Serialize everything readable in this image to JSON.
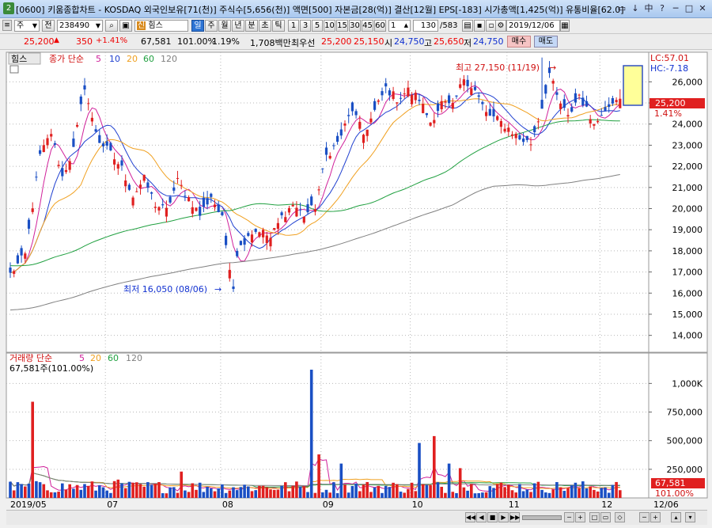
{
  "window": {
    "title": "[0600] 키움종합차트 - KOSDAQ 외국인보유[71(천)] 주식수[5,656(천)] 액면[500] 자본금[28(억)] 결산[12월] EPS[-183] 시가총액[1,425(억)] 유통비율[62.0]",
    "icon_label": "2",
    "buttons": [
      "▭",
      "↓",
      "中",
      "?",
      "─",
      "□",
      "✕"
    ]
  },
  "toolbar1": {
    "market": "주",
    "prev_label": "전",
    "code": "238490",
    "name": "힘스",
    "name_prefix": "신",
    "periods": [
      "일",
      "주",
      "월",
      "년",
      "분",
      "초",
      "틱"
    ],
    "active_period": "일",
    "intervals": [
      "1",
      "3",
      "5",
      "10",
      "15",
      "30",
      "45",
      "60"
    ],
    "interval_value": "1",
    "count": "130",
    "total": "/583",
    "date": "2019/12/06"
  },
  "toolbar2": {
    "price": "25,200",
    "change_arrow": "▲",
    "change": "350",
    "change_pct": "+1.41%",
    "volume": "67,581",
    "volume_pct": "101.00%",
    "turnover": "1.19%",
    "amount": "1,708백만",
    "best_label": "최우선",
    "ask": "25,200",
    "bid": "25,150",
    "open_label": "시",
    "open": "24,750",
    "high_label": "고",
    "high": "25,650",
    "low_label": "저",
    "low": "24,750",
    "buy_label": "매수",
    "sell_label": "매도"
  },
  "price_panel": {
    "title": "힘스",
    "legend_prefix": "종가 단순",
    "ma_labels": [
      "5",
      "10",
      "20",
      "60",
      "120"
    ],
    "high_annotation": "최고 27,150 (11/19)",
    "low_annotation": "최저 16,050 (08/06)",
    "lc_label": "LC:57.01",
    "hc_label": "HC:-7.18",
    "current_tag": "25,200",
    "pct_tag": "1.41%"
  },
  "volume_panel": {
    "legend_prefix": "거래량 단순",
    "ma_labels": [
      "5",
      "20",
      "60",
      "120"
    ],
    "value_label": "67,581주(101.00%)",
    "current_tag": "67,581",
    "pct_tag": "101.00%"
  },
  "colors": {
    "up": "#e02020",
    "down": "#1a4fc4",
    "ma5": "#d0209a",
    "ma10": "#2040d0",
    "ma20": "#f0a020",
    "ma60": "#20a040",
    "ma120": "#808080",
    "grid": "#b8b8b8",
    "panel_bg": "#ffffff"
  },
  "chart_data": {
    "type": "candlestick",
    "price_axis": {
      "ticks": [
        14000,
        15000,
        16000,
        17000,
        18000,
        19000,
        20000,
        21000,
        22000,
        23000,
        24000,
        25000,
        26000
      ],
      "labels": [
        "14,000",
        "15,000",
        "16,000",
        "17,000",
        "18,000",
        "19,000",
        "20,000",
        "21,000",
        "22,000",
        "23,000",
        "24,000",
        "25,000",
        "26,000"
      ],
      "range": [
        13200,
        27400
      ]
    },
    "volume_axis": {
      "ticks": [
        250000,
        500000,
        750000,
        1000000
      ],
      "labels": [
        "250,000",
        "500,000",
        "750,000",
        "1,000K"
      ],
      "range": [
        0,
        1120000
      ]
    },
    "x_labels": [
      {
        "label": "2019/05",
        "index": 0
      },
      {
        "label": "07",
        "index": 26
      },
      {
        "label": "08",
        "index": 57
      },
      {
        "label": "09",
        "index": 84
      },
      {
        "label": "10",
        "index": 108
      },
      {
        "label": "11",
        "index": 134
      },
      {
        "label": "12",
        "index": 159
      },
      {
        "label": "12/06",
        "index": 164
      }
    ],
    "moving_average_periods": [
      5,
      10,
      20,
      60,
      120
    ],
    "waypoints": [
      [
        0,
        16900
      ],
      [
        4,
        17800
      ],
      [
        8,
        22500
      ],
      [
        11,
        23600
      ],
      [
        14,
        21500
      ],
      [
        17,
        22800
      ],
      [
        20,
        25800
      ],
      [
        22,
        24200
      ],
      [
        24,
        23200
      ],
      [
        27,
        22600
      ],
      [
        30,
        21900
      ],
      [
        33,
        20600
      ],
      [
        36,
        21400
      ],
      [
        39,
        20200
      ],
      [
        42,
        19900
      ],
      [
        45,
        21300
      ],
      [
        48,
        20500
      ],
      [
        51,
        19700
      ],
      [
        54,
        20600
      ],
      [
        57,
        19500
      ],
      [
        58,
        18300
      ],
      [
        60,
        16300
      ],
      [
        61,
        17900
      ],
      [
        64,
        18800
      ],
      [
        67,
        19000
      ],
      [
        70,
        18600
      ],
      [
        73,
        19600
      ],
      [
        76,
        20200
      ],
      [
        79,
        19700
      ],
      [
        82,
        20100
      ],
      [
        85,
        22500
      ],
      [
        88,
        23100
      ],
      [
        92,
        24700
      ],
      [
        95,
        23500
      ],
      [
        98,
        24600
      ],
      [
        101,
        25700
      ],
      [
        104,
        25200
      ],
      [
        107,
        25600
      ],
      [
        110,
        25200
      ],
      [
        113,
        24100
      ],
      [
        116,
        25000
      ],
      [
        119,
        24800
      ],
      [
        122,
        26200
      ],
      [
        125,
        25600
      ],
      [
        128,
        24500
      ],
      [
        131,
        24200
      ],
      [
        134,
        23800
      ],
      [
        137,
        23300
      ],
      [
        140,
        23100
      ],
      [
        143,
        24800
      ],
      [
        145,
        26400
      ],
      [
        147,
        25300
      ],
      [
        150,
        24300
      ],
      [
        153,
        25400
      ],
      [
        156,
        24300
      ],
      [
        158,
        24100
      ],
      [
        160,
        24800
      ],
      [
        163,
        25300
      ],
      [
        164,
        25200
      ]
    ],
    "last_bar": {
      "open": 24750,
      "high": 25650,
      "low": 24750,
      "close": 25200,
      "volume": 67581
    },
    "high_bar": {
      "index": 143,
      "value": 27150,
      "date": "11/19"
    },
    "low_bar": {
      "index": 60,
      "value": 16050,
      "date": "08/06"
    },
    "volume_spikes": [
      {
        "index": 6,
        "value": 840000
      },
      {
        "index": 9,
        "value": 120000
      },
      {
        "index": 29,
        "value": 160000
      },
      {
        "index": 46,
        "value": 230000
      },
      {
        "index": 81,
        "value": 1120000
      },
      {
        "index": 83,
        "value": 380000
      },
      {
        "index": 89,
        "value": 300000
      },
      {
        "index": 110,
        "value": 480000
      },
      {
        "index": 114,
        "value": 540000
      },
      {
        "index": 118,
        "value": 300000
      },
      {
        "index": 121,
        "value": 260000
      }
    ]
  }
}
